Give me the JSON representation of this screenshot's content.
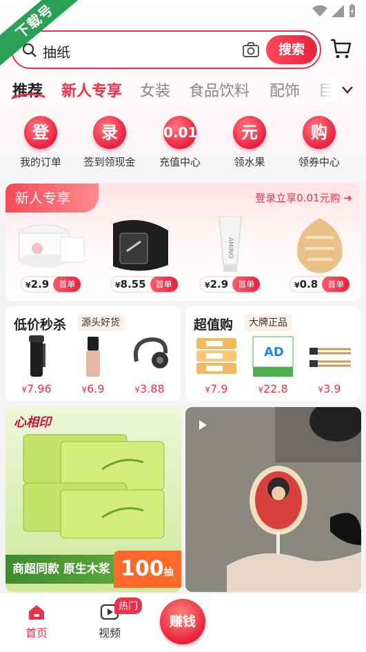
{
  "watermark": "下载号",
  "search": {
    "query": "抽纸",
    "button": "搜索"
  },
  "tabs": [
    "推荐",
    "新人专享",
    "女装",
    "食品饮料",
    "配饰",
    "巨"
  ],
  "quick": [
    {
      "icon": "登",
      "label": "我的订单"
    },
    {
      "icon": "录",
      "label": "签到领现金"
    },
    {
      "icon": "0.01",
      "label": "充值中心"
    },
    {
      "icon": "元",
      "label": "领水果"
    },
    {
      "icon": "购",
      "label": "领券中心"
    }
  ],
  "newuser": {
    "title": "新人专享",
    "login": "登录立享0.01元购",
    "products": [
      {
        "name": "tissue-packs",
        "currency": "¥",
        "price": "2.9",
        "tag": "首单"
      },
      {
        "name": "leather-belt",
        "currency": "¥",
        "price": "8.55",
        "tag": "首单"
      },
      {
        "name": "cleanser-tube",
        "currency": "¥",
        "price": "2.9",
        "tag": "首单"
      },
      {
        "name": "makeup-puff",
        "currency": "¥",
        "price": "0.8",
        "tag": "首单"
      }
    ]
  },
  "flash": {
    "title": "低价秒杀",
    "badge": "源头好货",
    "items": [
      {
        "currency": "¥",
        "price": "7.96"
      },
      {
        "currency": "¥",
        "price": "6.9"
      },
      {
        "currency": "¥",
        "price": "3.88"
      }
    ]
  },
  "brand": {
    "title": "超值购",
    "badge": "大牌正品",
    "items": [
      {
        "currency": "¥",
        "price": "7.9"
      },
      {
        "currency": "¥",
        "price": "22.8"
      },
      {
        "currency": "¥",
        "price": "3.9"
      }
    ]
  },
  "feed": {
    "card1": {
      "brand": "心相印",
      "slogan": "商超同款 原生木浆",
      "count": "100",
      "unit": "抽"
    }
  },
  "nav": {
    "home": "首页",
    "video": "视频",
    "hot": "热门",
    "earn": "赚钱"
  }
}
